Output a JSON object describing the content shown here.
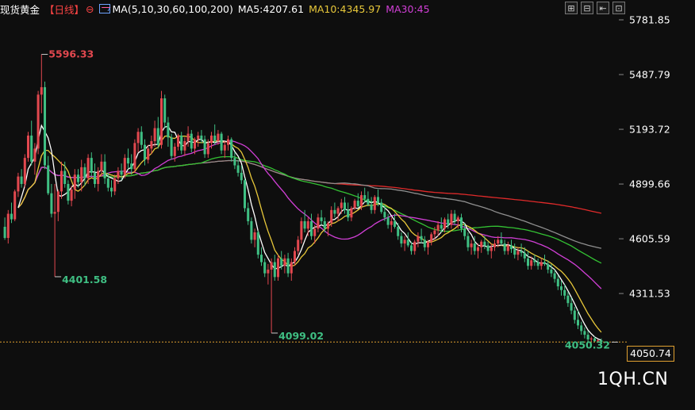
{
  "header": {
    "symbol": "现货黄金",
    "period": "【日线】",
    "ma_label": "MA(5,10,30,60,100,200)",
    "ma5": "MA5:4207.61",
    "ma10": "MA10:4345.97",
    "ma30": "MA30:45"
  },
  "toolbar": [
    "⊞",
    "⊟",
    "⇤",
    "⊡"
  ],
  "watermark": "1QH.CN",
  "current_price": "4050.74",
  "colors": {
    "background": "#0e0e0e",
    "up": "#e2484f",
    "down": "#3fbf83",
    "ma5": "#ffffff",
    "ma10": "#e8c83a",
    "ma30": "#d13fd6",
    "ma60": "#33c233",
    "ma100": "#8f8f8f",
    "ma200": "#e02a2a",
    "axis_text": "#ffffff",
    "price_line": "#e0a030"
  },
  "chart_data": {
    "type": "candlestick",
    "y_ticks": [
      "5781.85",
      "5487.79",
      "5193.72",
      "4899.66",
      "4605.59",
      "4311.53"
    ],
    "ylim": [
      4000,
      5825
    ],
    "annotations": [
      {
        "label": "5596.33",
        "value": 5596.33,
        "bar": 11,
        "kind": "high"
      },
      {
        "label": "4401.58",
        "value": 4401.58,
        "bar": 15,
        "kind": "low"
      },
      {
        "label": "4099.02",
        "value": 4099.02,
        "bar": 80,
        "kind": "low"
      },
      {
        "label": "4050.32",
        "value": 4050.32,
        "bar": 184,
        "kind": "low"
      }
    ],
    "candles": [
      [
        4670,
        4720,
        4600,
        4610
      ],
      [
        4610,
        4760,
        4580,
        4740
      ],
      [
        4740,
        4800,
        4690,
        4710
      ],
      [
        4710,
        4870,
        4700,
        4860
      ],
      [
        4860,
        4960,
        4830,
        4940
      ],
      [
        4940,
        4980,
        4880,
        4900
      ],
      [
        4900,
        5060,
        4880,
        5040
      ],
      [
        5040,
        5180,
        5020,
        5160
      ],
      [
        5160,
        5240,
        5000,
        5020
      ],
      [
        5020,
        5120,
        4950,
        5090
      ],
      [
        5090,
        5400,
        5060,
        5380
      ],
      [
        5380,
        5596.33,
        5280,
        5420
      ],
      [
        5420,
        5450,
        4980,
        5000
      ],
      [
        5000,
        5050,
        4840,
        4850
      ],
      [
        4850,
        4900,
        4720,
        4740
      ],
      [
        4740,
        4900,
        4401.58,
        4750
      ],
      [
        4750,
        4870,
        4700,
        4860
      ],
      [
        4860,
        5020,
        4820,
        4970
      ],
      [
        4970,
        5020,
        4880,
        4900
      ],
      [
        4900,
        4920,
        4790,
        4810
      ],
      [
        4810,
        4890,
        4780,
        4870
      ],
      [
        4870,
        4980,
        4820,
        4950
      ],
      [
        4950,
        4980,
        4880,
        4910
      ],
      [
        4910,
        5030,
        4860,
        4990
      ],
      [
        4990,
        5010,
        4890,
        4930
      ],
      [
        4930,
        5060,
        4900,
        5040
      ],
      [
        5040,
        5070,
        4940,
        4960
      ],
      [
        4960,
        5010,
        4880,
        4900
      ],
      [
        4900,
        4990,
        4860,
        4970
      ],
      [
        4970,
        5060,
        4940,
        5020
      ],
      [
        5020,
        5060,
        4900,
        4930
      ],
      [
        4930,
        4960,
        4860,
        4880
      ],
      [
        4880,
        4920,
        4830,
        4860
      ],
      [
        4860,
        4950,
        4840,
        4930
      ],
      [
        4930,
        4990,
        4900,
        4970
      ],
      [
        4970,
        5010,
        4920,
        4950
      ],
      [
        4950,
        5060,
        4930,
        5040
      ],
      [
        5040,
        5090,
        4980,
        5010
      ],
      [
        5010,
        5060,
        4950,
        4980
      ],
      [
        4980,
        5140,
        4960,
        5120
      ],
      [
        5120,
        5200,
        5070,
        5180
      ],
      [
        5180,
        5210,
        5090,
        5110
      ],
      [
        5110,
        5140,
        5000,
        5030
      ],
      [
        5030,
        5110,
        5010,
        5090
      ],
      [
        5090,
        5160,
        5060,
        5130
      ],
      [
        5130,
        5240,
        5100,
        5200
      ],
      [
        5200,
        5260,
        5090,
        5110
      ],
      [
        5110,
        5400,
        5090,
        5360
      ],
      [
        5360,
        5380,
        5200,
        5230
      ],
      [
        5230,
        5260,
        5100,
        5150
      ],
      [
        5150,
        5170,
        5030,
        5050
      ],
      [
        5050,
        5120,
        5020,
        5100
      ],
      [
        5100,
        5170,
        5080,
        5160
      ],
      [
        5160,
        5180,
        5060,
        5080
      ],
      [
        5080,
        5150,
        5050,
        5130
      ],
      [
        5130,
        5210,
        5100,
        5170
      ],
      [
        5170,
        5190,
        5070,
        5090
      ],
      [
        5090,
        5150,
        5060,
        5140
      ],
      [
        5140,
        5180,
        5100,
        5160
      ],
      [
        5160,
        5190,
        5120,
        5140
      ],
      [
        5140,
        5160,
        5040,
        5060
      ],
      [
        5060,
        5140,
        5040,
        5120
      ],
      [
        5120,
        5180,
        5090,
        5160
      ],
      [
        5160,
        5220,
        5110,
        5130
      ],
      [
        5130,
        5190,
        5110,
        5170
      ],
      [
        5170,
        5180,
        5060,
        5080
      ],
      [
        5080,
        5130,
        5040,
        5110
      ],
      [
        5110,
        5160,
        5080,
        5140
      ],
      [
        5140,
        5150,
        5020,
        5040
      ],
      [
        5040,
        5070,
        4980,
        5000
      ],
      [
        5000,
        5030,
        4940,
        4960
      ],
      [
        4960,
        5000,
        4900,
        4920
      ],
      [
        4920,
        4930,
        4750,
        4770
      ],
      [
        4770,
        4800,
        4680,
        4700
      ],
      [
        4700,
        4720,
        4580,
        4600
      ],
      [
        4600,
        4660,
        4560,
        4640
      ],
      [
        4640,
        4650,
        4500,
        4520
      ],
      [
        4520,
        4560,
        4460,
        4480
      ],
      [
        4480,
        4500,
        4400,
        4420
      ],
      [
        4420,
        4470,
        4360,
        4440
      ],
      [
        4440,
        4500,
        4099.02,
        4480
      ],
      [
        4480,
        4520,
        4380,
        4400
      ],
      [
        4400,
        4520,
        4380,
        4500
      ],
      [
        4500,
        4540,
        4440,
        4460
      ],
      [
        4460,
        4520,
        4420,
        4500
      ],
      [
        4500,
        4530,
        4400,
        4420
      ],
      [
        4420,
        4500,
        4380,
        4480
      ],
      [
        4480,
        4560,
        4460,
        4540
      ],
      [
        4540,
        4620,
        4520,
        4600
      ],
      [
        4600,
        4720,
        4580,
        4700
      ],
      [
        4700,
        4760,
        4640,
        4660
      ],
      [
        4660,
        4720,
        4620,
        4700
      ],
      [
        4700,
        4740,
        4600,
        4620
      ],
      [
        4620,
        4680,
        4580,
        4660
      ],
      [
        4660,
        4740,
        4640,
        4720
      ],
      [
        4720,
        4760,
        4680,
        4700
      ],
      [
        4700,
        4720,
        4640,
        4660
      ],
      [
        4660,
        4700,
        4620,
        4690
      ],
      [
        4690,
        4780,
        4670,
        4760
      ],
      [
        4760,
        4800,
        4720,
        4740
      ],
      [
        4740,
        4780,
        4700,
        4770
      ],
      [
        4770,
        4820,
        4740,
        4800
      ],
      [
        4800,
        4830,
        4740,
        4760
      ],
      [
        4760,
        4800,
        4700,
        4720
      ],
      [
        4720,
        4780,
        4700,
        4770
      ],
      [
        4770,
        4820,
        4760,
        4810
      ],
      [
        4810,
        4850,
        4770,
        4780
      ],
      [
        4780,
        4860,
        4760,
        4840
      ],
      [
        4840,
        4880,
        4800,
        4820
      ],
      [
        4820,
        4860,
        4780,
        4790
      ],
      [
        4790,
        4830,
        4740,
        4760
      ],
      [
        4760,
        4840,
        4740,
        4830
      ],
      [
        4830,
        4870,
        4780,
        4800
      ],
      [
        4800,
        4820,
        4740,
        4750
      ],
      [
        4750,
        4790,
        4700,
        4720
      ],
      [
        4720,
        4740,
        4660,
        4680
      ],
      [
        4680,
        4720,
        4640,
        4700
      ],
      [
        4700,
        4740,
        4660,
        4670
      ],
      [
        4670,
        4690,
        4600,
        4620
      ],
      [
        4620,
        4640,
        4560,
        4580
      ],
      [
        4580,
        4620,
        4540,
        4600
      ],
      [
        4600,
        4640,
        4560,
        4570
      ],
      [
        4570,
        4590,
        4520,
        4540
      ],
      [
        4540,
        4600,
        4520,
        4590
      ],
      [
        4590,
        4640,
        4560,
        4620
      ],
      [
        4620,
        4660,
        4580,
        4600
      ],
      [
        4600,
        4620,
        4540,
        4560
      ],
      [
        4560,
        4600,
        4520,
        4590
      ],
      [
        4590,
        4640,
        4570,
        4630
      ],
      [
        4630,
        4670,
        4600,
        4650
      ],
      [
        4650,
        4700,
        4620,
        4680
      ],
      [
        4680,
        4720,
        4640,
        4660
      ],
      [
        4660,
        4720,
        4640,
        4710
      ],
      [
        4710,
        4740,
        4660,
        4680
      ],
      [
        4680,
        4760,
        4660,
        4740
      ],
      [
        4740,
        4760,
        4680,
        4700
      ],
      [
        4700,
        4730,
        4660,
        4720
      ],
      [
        4720,
        4740,
        4640,
        4660
      ],
      [
        4660,
        4690,
        4600,
        4620
      ],
      [
        4620,
        4640,
        4540,
        4560
      ],
      [
        4560,
        4600,
        4520,
        4580
      ],
      [
        4580,
        4620,
        4520,
        4540
      ],
      [
        4540,
        4580,
        4500,
        4560
      ],
      [
        4560,
        4600,
        4530,
        4590
      ],
      [
        4590,
        4620,
        4550,
        4570
      ],
      [
        4570,
        4590,
        4520,
        4540
      ],
      [
        4540,
        4580,
        4500,
        4560
      ],
      [
        4560,
        4600,
        4540,
        4580
      ],
      [
        4580,
        4620,
        4560,
        4600
      ],
      [
        4600,
        4640,
        4570,
        4580
      ],
      [
        4580,
        4600,
        4520,
        4540
      ],
      [
        4540,
        4590,
        4520,
        4570
      ],
      [
        4570,
        4600,
        4530,
        4550
      ],
      [
        4550,
        4580,
        4500,
        4520
      ],
      [
        4520,
        4560,
        4490,
        4540
      ],
      [
        4540,
        4580,
        4510,
        4530
      ],
      [
        4530,
        4560,
        4480,
        4500
      ],
      [
        4500,
        4540,
        4440,
        4460
      ],
      [
        4460,
        4510,
        4440,
        4490
      ],
      [
        4490,
        4520,
        4460,
        4480
      ],
      [
        4480,
        4500,
        4440,
        4460
      ],
      [
        4460,
        4500,
        4440,
        4480
      ],
      [
        4480,
        4520,
        4460,
        4470
      ],
      [
        4470,
        4490,
        4420,
        4440
      ],
      [
        4440,
        4470,
        4400,
        4420
      ],
      [
        4420,
        4440,
        4370,
        4390
      ],
      [
        4390,
        4410,
        4330,
        4350
      ],
      [
        4350,
        4380,
        4300,
        4330
      ],
      [
        4330,
        4360,
        4280,
        4300
      ],
      [
        4300,
        4320,
        4240,
        4260
      ],
      [
        4260,
        4290,
        4200,
        4220
      ],
      [
        4220,
        4240,
        4150,
        4170
      ],
      [
        4170,
        4220,
        4120,
        4140
      ],
      [
        4140,
        4160,
        4090,
        4110
      ],
      [
        4110,
        4130,
        4070,
        4090
      ],
      [
        4090,
        4110,
        4050.32,
        4065
      ],
      [
        4065,
        4080,
        4052,
        4070
      ],
      [
        4070,
        4080,
        4050.32,
        4055
      ],
      [
        4055,
        4065,
        4050.32,
        4060
      ],
      [
        4060,
        4070,
        4050.32,
        4050.74
      ]
    ]
  }
}
